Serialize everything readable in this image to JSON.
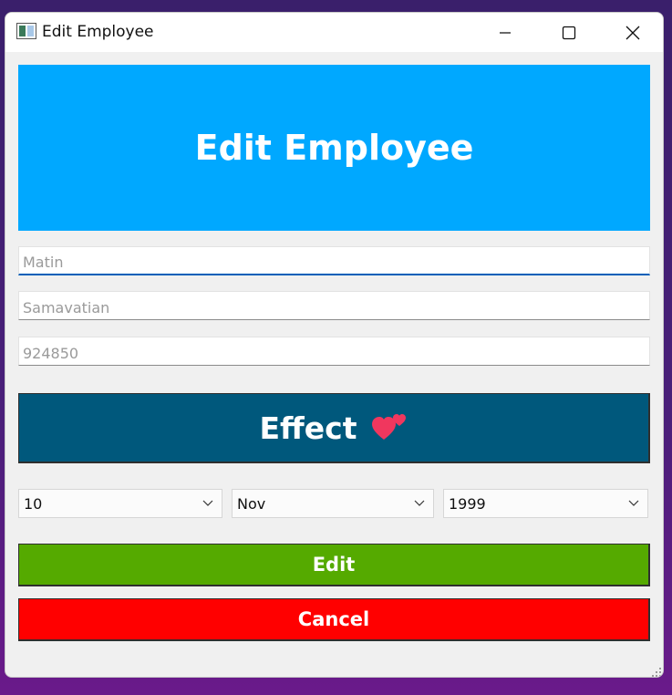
{
  "window": {
    "title": "Edit Employee"
  },
  "header": {
    "title": "Edit Employee",
    "color": "#00a8ff"
  },
  "form": {
    "first_name": {
      "placeholder": "Matin"
    },
    "last_name": {
      "placeholder": "Samavatian"
    },
    "code": {
      "placeholder": "924850"
    }
  },
  "effect_button": {
    "label": "Effect",
    "icon": "two-hearts-icon",
    "color": "#00587c"
  },
  "date": {
    "day": "10",
    "month": "Nov",
    "year": "1999"
  },
  "actions": {
    "edit_label": "Edit",
    "edit_color": "#55aa00",
    "cancel_label": "Cancel",
    "cancel_color": "#ff0000"
  }
}
